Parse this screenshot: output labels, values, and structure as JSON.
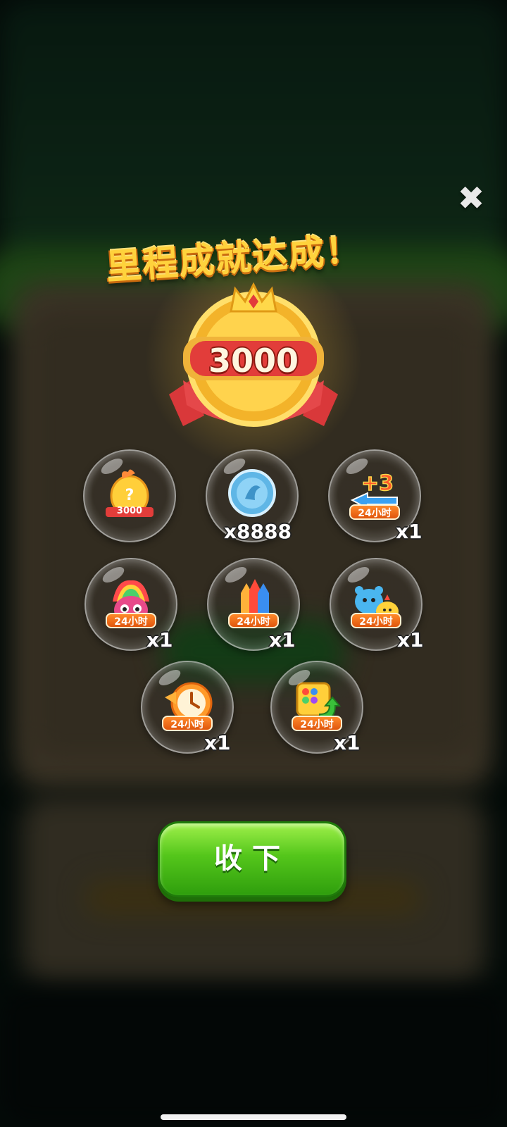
{
  "dialog": {
    "title": "里程成就达成！",
    "milestone": "3000",
    "close_icon": "close-icon",
    "claim_label": "收下"
  },
  "rewards": [
    {
      "name": "mystery-egg",
      "badge": "",
      "quantity": "",
      "icon": "mystery-egg-icon",
      "egg_label": "3000"
    },
    {
      "name": "coin",
      "badge": "",
      "quantity": "x8888",
      "icon": "coin-icon"
    },
    {
      "name": "plus-three-moves",
      "badge": "24小时",
      "quantity": "x1",
      "icon": "plus-three-icon",
      "icon_text": "+3"
    },
    {
      "name": "rainbow-bird",
      "badge": "24小时",
      "quantity": "x1",
      "icon": "rainbow-bird-icon"
    },
    {
      "name": "rockets",
      "badge": "24小时",
      "quantity": "x1",
      "icon": "rocket-icon"
    },
    {
      "name": "animal-friends",
      "badge": "24小时",
      "quantity": "x1",
      "icon": "animal-friends-icon"
    },
    {
      "name": "clock",
      "badge": "24小时",
      "quantity": "x1",
      "icon": "clock-icon"
    },
    {
      "name": "shuffle-board",
      "badge": "24小时",
      "quantity": "x1",
      "icon": "shuffle-icon"
    }
  ]
}
